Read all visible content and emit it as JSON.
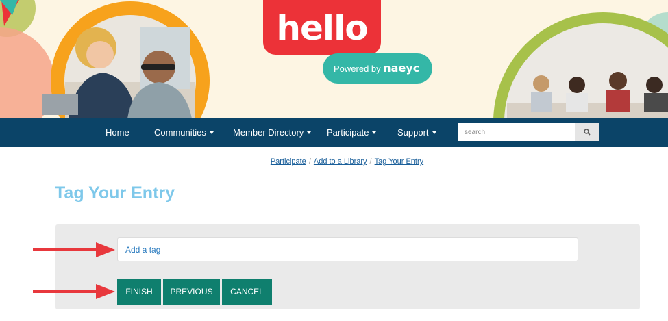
{
  "banner": {
    "logo_hello": "hello",
    "logo_powered_prefix": "Powered by",
    "logo_powered_brand": "naeyc"
  },
  "nav": {
    "items": [
      {
        "label": "Home",
        "dropdown": false
      },
      {
        "label": "Communities",
        "dropdown": true
      },
      {
        "label": "Member Directory",
        "dropdown": true
      },
      {
        "label": "Participate",
        "dropdown": true
      },
      {
        "label": "Support",
        "dropdown": true
      }
    ],
    "search": {
      "placeholder": "search",
      "icon": "search-icon"
    }
  },
  "breadcrumb": [
    "Participate",
    "Add to a Library",
    "Tag Your Entry"
  ],
  "page": {
    "title": "Tag Your Entry",
    "tag_input": {
      "placeholder": "Add a tag",
      "value": ""
    },
    "buttons": {
      "finish": "FINISH",
      "previous": "PREVIOUS",
      "cancel": "CANCEL"
    }
  },
  "annotations": {
    "arrow_color": "#e8383d"
  },
  "colors": {
    "nav_bg": "#0b4468",
    "title": "#7ec8ea",
    "button": "#0f7f6e",
    "hello_red": "#ec3238",
    "naeyc_teal": "#34b7a7"
  }
}
